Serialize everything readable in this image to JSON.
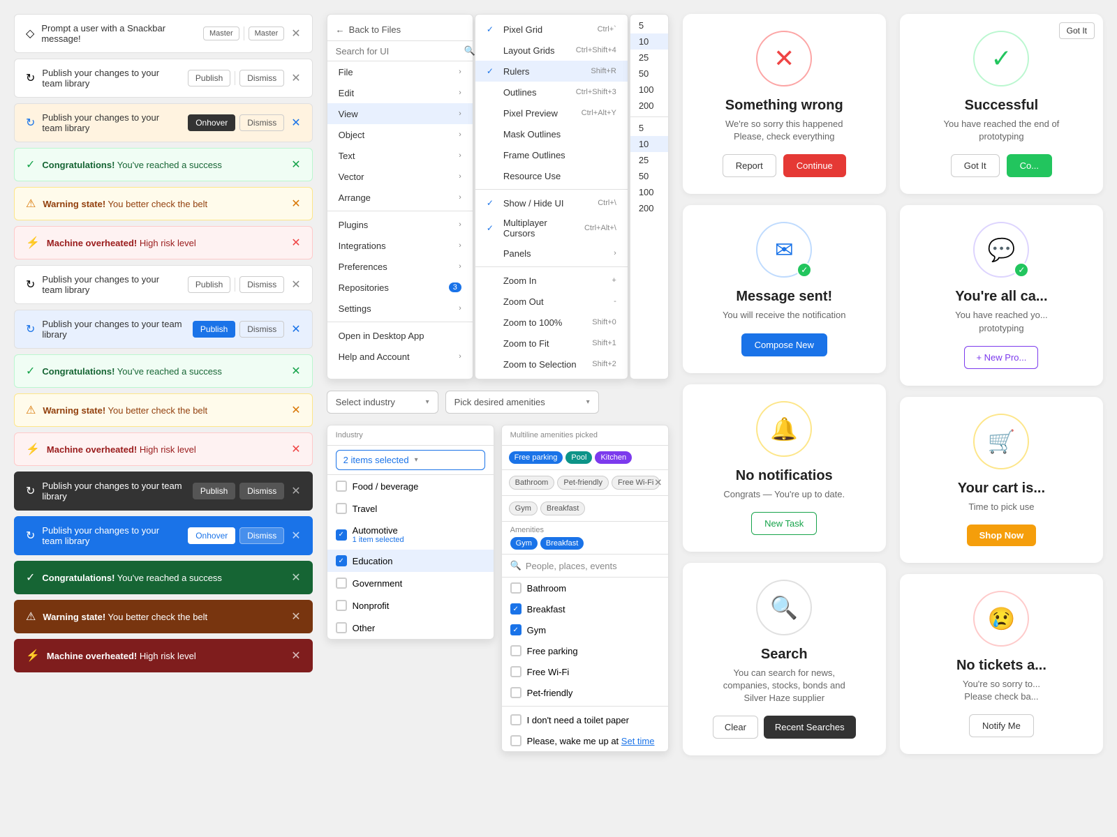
{
  "snackbars": [
    {
      "id": "sb1",
      "type": "default",
      "icon": "◇",
      "text": "Prompt a user with a Snackbar message!",
      "tags": [
        "Master",
        "Master"
      ],
      "showClose": true
    },
    {
      "id": "sb2",
      "type": "default",
      "icon": "↻",
      "text": "Publish your changes to your team library",
      "actionBtn": "Publish",
      "dismissBtn": "Dismiss",
      "showClose": true
    },
    {
      "id": "sb3",
      "type": "default-hover",
      "icon": "↻",
      "text": "Publish your changes to your team library",
      "actionBtn": "Onhover",
      "dismissBtn": "Dismiss",
      "showClose": true
    },
    {
      "id": "sb4",
      "type": "success-light",
      "icon": "✓",
      "text_bold": "Congratulations!",
      "text_rest": " You've reached a success",
      "showClose": true
    },
    {
      "id": "sb5",
      "type": "warning-light",
      "icon": "⚠",
      "text_bold": "Warning state!",
      "text_rest": " You better check the belt",
      "showClose": true
    },
    {
      "id": "sb6",
      "type": "error-light",
      "icon": "⚡",
      "text_bold": "Machine overheated!",
      "text_rest": " High risk level",
      "showClose": true
    },
    {
      "id": "sb7",
      "type": "default",
      "icon": "↻",
      "text": "Publish your changes to your team library",
      "actionBtn": "Publish",
      "dismissBtn": "Dismiss",
      "showClose": true
    },
    {
      "id": "sb8",
      "type": "default",
      "icon": "↻",
      "text": "Publish your changes to your team library",
      "actionBtn": "Publish",
      "dismissBtn": "Dismiss",
      "showClose": true
    },
    {
      "id": "sb9",
      "type": "success-light",
      "icon": "✓",
      "text_bold": "Congratulations!",
      "text_rest": " You've reached a success",
      "showClose": true
    },
    {
      "id": "sb10",
      "type": "warning-light",
      "icon": "⚠",
      "text_bold": "Warning state!",
      "text_rest": " You better check the belt",
      "showClose": true
    },
    {
      "id": "sb11",
      "type": "error-light",
      "icon": "⚡",
      "text_bold": "Machine overheated!",
      "text_rest": " High risk level",
      "showClose": true
    },
    {
      "id": "sb12",
      "type": "dark",
      "icon": "↻",
      "text": "Publish your changes to your team library",
      "actionBtn": "Publish",
      "dismissBtn": "Dismiss",
      "showClose": true
    },
    {
      "id": "sb13",
      "type": "blue",
      "icon": "↻",
      "text": "Publish your changes to your team library",
      "actionBtn": "Onhover",
      "dismissBtn": "Dismiss",
      "showClose": true
    },
    {
      "id": "sb14",
      "type": "success-dark",
      "icon": "✓",
      "text_bold": "Congratulations!",
      "text_rest": " You've reached a success",
      "showClose": true
    },
    {
      "id": "sb15",
      "type": "warning-dark",
      "icon": "⚠",
      "text_bold": "Warning state!",
      "text_rest": " You better check the belt",
      "showClose": true
    },
    {
      "id": "sb16",
      "type": "error-dark",
      "icon": "⚡",
      "text_bold": "Machine overheated!",
      "text_rest": " High risk level",
      "showClose": true
    }
  ],
  "menu": {
    "back_label": "Back to Files",
    "search_placeholder": "Search for UI",
    "items": [
      {
        "label": "File",
        "hasArrow": true
      },
      {
        "label": "Edit",
        "hasArrow": true
      },
      {
        "label": "View",
        "hasArrow": true,
        "active": true
      },
      {
        "label": "Object",
        "hasArrow": true
      },
      {
        "label": "Text",
        "hasArrow": true
      },
      {
        "label": "Vector",
        "hasArrow": true
      },
      {
        "label": "Arrange",
        "hasArrow": true
      },
      {
        "label": "Plugins",
        "hasArrow": true
      },
      {
        "label": "Integrations",
        "hasArrow": true
      },
      {
        "label": "Preferences",
        "hasArrow": true
      },
      {
        "label": "Repositories",
        "hasArrow": true,
        "badge": "3"
      },
      {
        "label": "Settings",
        "hasArrow": true
      }
    ],
    "bottom_items": [
      {
        "label": "Open in Desktop App"
      },
      {
        "label": "Help and Account",
        "hasArrow": true
      }
    ]
  },
  "submenu": {
    "items": [
      {
        "label": "Pixel Grid",
        "shortcut": "Ctrl+`",
        "checked": true
      },
      {
        "label": "Layout Grids",
        "shortcut": "Ctrl+Shift+4"
      },
      {
        "label": "Rulers",
        "shortcut": "Shift+R",
        "checked": true,
        "active": true
      },
      {
        "label": "Outlines",
        "shortcut": "Ctrl+Shift+3"
      },
      {
        "label": "Pixel Preview",
        "shortcut": "Ctrl+Alt+Y"
      },
      {
        "label": "Mask Outlines"
      },
      {
        "label": "Frame Outlines"
      },
      {
        "label": "Resource Use"
      },
      {
        "label": "Show / Hide UI",
        "shortcut": "Ctrl+\\",
        "checked": true
      },
      {
        "label": "Multiplayer Cursors",
        "shortcut": "Ctrl+Alt+\\",
        "checked": true
      },
      {
        "label": "Panels",
        "hasArrow": true
      },
      {
        "label": "Zoom In",
        "shortcut": "+"
      },
      {
        "label": "Zoom Out",
        "shortcut": "-"
      },
      {
        "label": "Zoom to 100%",
        "shortcut": "Shift+0"
      },
      {
        "label": "Zoom to Fit",
        "shortcut": "Shift+1"
      },
      {
        "label": "Zoom to Selection",
        "shortcut": "Shift+2"
      }
    ]
  },
  "numbers": {
    "items": [
      "5",
      "10",
      "25",
      "50",
      "100",
      "200"
    ],
    "highlighted": "10",
    "items2": [
      "5",
      "10",
      "25",
      "50",
      "100",
      "200"
    ],
    "highlighted2": "10"
  },
  "dropdowns": {
    "industry_placeholder": "Select industry",
    "amenities_placeholder": "Pick desired amenities",
    "industry_selected": "2 items selected",
    "industry_items": [
      {
        "label": "Food / beverage",
        "checked": false
      },
      {
        "label": "Travel",
        "checked": false
      },
      {
        "label": "Automotive",
        "checked": true,
        "sub": "1 item selected"
      },
      {
        "label": "Education",
        "checked": true
      },
      {
        "label": "Government",
        "checked": false
      },
      {
        "label": "Nonprofit",
        "checked": false
      },
      {
        "label": "Other",
        "checked": false
      }
    ],
    "amenities_tags_top": [
      "Free parking",
      "Pool",
      "Kitchen"
    ],
    "amenities_tags_row2": [
      "Bathroom",
      "Pet-friendly",
      "Free Wi-Fi"
    ],
    "amenities_tags_row3": [
      "Gym",
      "Breakfast"
    ],
    "amenities_section_label": "Amenities",
    "amenities_selected": [
      "Gym",
      "Breakfast"
    ],
    "amenities_search_placeholder": "People, places, events",
    "amenities_items": [
      {
        "label": "Bathroom",
        "checked": false
      },
      {
        "label": "Breakfast",
        "checked": true
      },
      {
        "label": "Gym",
        "checked": true
      },
      {
        "label": "Free parking",
        "checked": false
      },
      {
        "label": "Free Wi-Fi",
        "checked": false
      },
      {
        "label": "Pet-friendly",
        "checked": false
      }
    ],
    "amenities_extras": [
      {
        "label": "I don't need a toilet paper"
      },
      {
        "label": "Please, wake me up at Set time"
      }
    ]
  },
  "status_cards": {
    "wrong": {
      "icon": "✕",
      "icon_color": "#ef4444",
      "title": "Something wrong",
      "desc": "We're so sorry this happened\nPlease, check everything",
      "btn1": "Report",
      "btn2": "Continue"
    },
    "success": {
      "icon": "✓",
      "icon_color": "#22c55e",
      "title": "Successful",
      "desc": "You have reached the end of\nprototyping",
      "btn1": "Got It",
      "btn2": "C..."
    },
    "message_sent": {
      "icon": "✉",
      "icon_color": "#1a73e8",
      "check": true,
      "title": "Message sent!",
      "desc": "You will receive the notification",
      "btn1": "Compose New"
    },
    "all_caught": {
      "icon": "💬",
      "icon_color": "#7c3aed",
      "check": true,
      "title": "You're all ca...",
      "desc": "You have reached yo...\nprototyping",
      "btn1": "+ New Pro..."
    },
    "no_notif": {
      "icon": "🔔",
      "icon_color": "#f59e0b",
      "title": "No notificatios",
      "desc": "Congrats — You're up to date.",
      "btn1": "New Task"
    },
    "cart": {
      "icon": "🛒",
      "icon_color": "#f59e0b",
      "title": "Your cart is...",
      "desc": "Time to pick use",
      "btn1": "Shop Now"
    },
    "search": {
      "icon": "🔍",
      "icon_color": "#888",
      "title": "Search",
      "desc": "You can search for news,\ncompanies, stocks, bonds and\nSilver Haze supplier",
      "btn1": "Clear",
      "btn2": "Recent Searches"
    },
    "no_tickets": {
      "icon": "😢",
      "icon_color": "#ef4444",
      "title": "No tickets a...",
      "desc": "You're so sorry to...\nPlease check ba...",
      "btn1": "Notify Me"
    }
  }
}
